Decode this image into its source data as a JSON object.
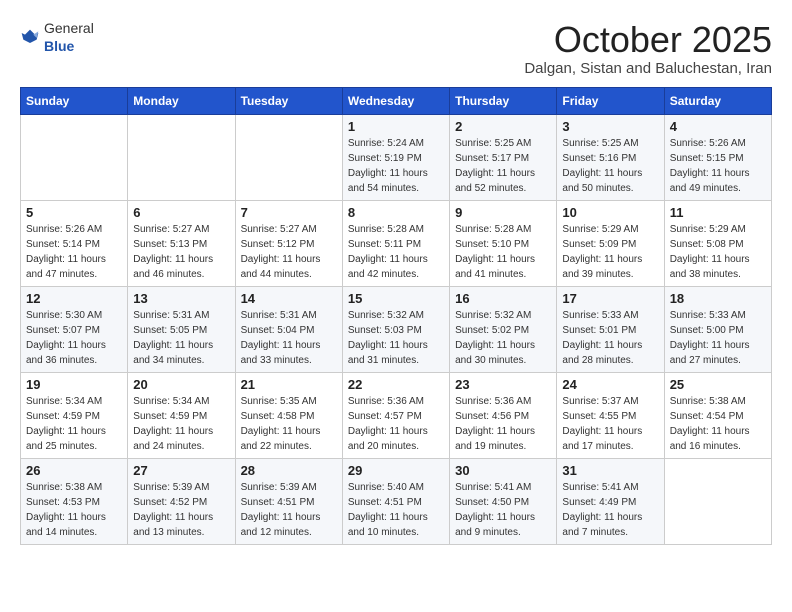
{
  "header": {
    "logo_general": "General",
    "logo_blue": "Blue",
    "month": "October 2025",
    "location": "Dalgan, Sistan and Baluchestan, Iran"
  },
  "days_of_week": [
    "Sunday",
    "Monday",
    "Tuesday",
    "Wednesday",
    "Thursday",
    "Friday",
    "Saturday"
  ],
  "weeks": [
    [
      {
        "day": "",
        "info": ""
      },
      {
        "day": "",
        "info": ""
      },
      {
        "day": "",
        "info": ""
      },
      {
        "day": "1",
        "info": "Sunrise: 5:24 AM\nSunset: 5:19 PM\nDaylight: 11 hours and 54 minutes."
      },
      {
        "day": "2",
        "info": "Sunrise: 5:25 AM\nSunset: 5:17 PM\nDaylight: 11 hours and 52 minutes."
      },
      {
        "day": "3",
        "info": "Sunrise: 5:25 AM\nSunset: 5:16 PM\nDaylight: 11 hours and 50 minutes."
      },
      {
        "day": "4",
        "info": "Sunrise: 5:26 AM\nSunset: 5:15 PM\nDaylight: 11 hours and 49 minutes."
      }
    ],
    [
      {
        "day": "5",
        "info": "Sunrise: 5:26 AM\nSunset: 5:14 PM\nDaylight: 11 hours and 47 minutes."
      },
      {
        "day": "6",
        "info": "Sunrise: 5:27 AM\nSunset: 5:13 PM\nDaylight: 11 hours and 46 minutes."
      },
      {
        "day": "7",
        "info": "Sunrise: 5:27 AM\nSunset: 5:12 PM\nDaylight: 11 hours and 44 minutes."
      },
      {
        "day": "8",
        "info": "Sunrise: 5:28 AM\nSunset: 5:11 PM\nDaylight: 11 hours and 42 minutes."
      },
      {
        "day": "9",
        "info": "Sunrise: 5:28 AM\nSunset: 5:10 PM\nDaylight: 11 hours and 41 minutes."
      },
      {
        "day": "10",
        "info": "Sunrise: 5:29 AM\nSunset: 5:09 PM\nDaylight: 11 hours and 39 minutes."
      },
      {
        "day": "11",
        "info": "Sunrise: 5:29 AM\nSunset: 5:08 PM\nDaylight: 11 hours and 38 minutes."
      }
    ],
    [
      {
        "day": "12",
        "info": "Sunrise: 5:30 AM\nSunset: 5:07 PM\nDaylight: 11 hours and 36 minutes."
      },
      {
        "day": "13",
        "info": "Sunrise: 5:31 AM\nSunset: 5:05 PM\nDaylight: 11 hours and 34 minutes."
      },
      {
        "day": "14",
        "info": "Sunrise: 5:31 AM\nSunset: 5:04 PM\nDaylight: 11 hours and 33 minutes."
      },
      {
        "day": "15",
        "info": "Sunrise: 5:32 AM\nSunset: 5:03 PM\nDaylight: 11 hours and 31 minutes."
      },
      {
        "day": "16",
        "info": "Sunrise: 5:32 AM\nSunset: 5:02 PM\nDaylight: 11 hours and 30 minutes."
      },
      {
        "day": "17",
        "info": "Sunrise: 5:33 AM\nSunset: 5:01 PM\nDaylight: 11 hours and 28 minutes."
      },
      {
        "day": "18",
        "info": "Sunrise: 5:33 AM\nSunset: 5:00 PM\nDaylight: 11 hours and 27 minutes."
      }
    ],
    [
      {
        "day": "19",
        "info": "Sunrise: 5:34 AM\nSunset: 4:59 PM\nDaylight: 11 hours and 25 minutes."
      },
      {
        "day": "20",
        "info": "Sunrise: 5:34 AM\nSunset: 4:59 PM\nDaylight: 11 hours and 24 minutes."
      },
      {
        "day": "21",
        "info": "Sunrise: 5:35 AM\nSunset: 4:58 PM\nDaylight: 11 hours and 22 minutes."
      },
      {
        "day": "22",
        "info": "Sunrise: 5:36 AM\nSunset: 4:57 PM\nDaylight: 11 hours and 20 minutes."
      },
      {
        "day": "23",
        "info": "Sunrise: 5:36 AM\nSunset: 4:56 PM\nDaylight: 11 hours and 19 minutes."
      },
      {
        "day": "24",
        "info": "Sunrise: 5:37 AM\nSunset: 4:55 PM\nDaylight: 11 hours and 17 minutes."
      },
      {
        "day": "25",
        "info": "Sunrise: 5:38 AM\nSunset: 4:54 PM\nDaylight: 11 hours and 16 minutes."
      }
    ],
    [
      {
        "day": "26",
        "info": "Sunrise: 5:38 AM\nSunset: 4:53 PM\nDaylight: 11 hours and 14 minutes."
      },
      {
        "day": "27",
        "info": "Sunrise: 5:39 AM\nSunset: 4:52 PM\nDaylight: 11 hours and 13 minutes."
      },
      {
        "day": "28",
        "info": "Sunrise: 5:39 AM\nSunset: 4:51 PM\nDaylight: 11 hours and 12 minutes."
      },
      {
        "day": "29",
        "info": "Sunrise: 5:40 AM\nSunset: 4:51 PM\nDaylight: 11 hours and 10 minutes."
      },
      {
        "day": "30",
        "info": "Sunrise: 5:41 AM\nSunset: 4:50 PM\nDaylight: 11 hours and 9 minutes."
      },
      {
        "day": "31",
        "info": "Sunrise: 5:41 AM\nSunset: 4:49 PM\nDaylight: 11 hours and 7 minutes."
      },
      {
        "day": "",
        "info": ""
      }
    ]
  ]
}
